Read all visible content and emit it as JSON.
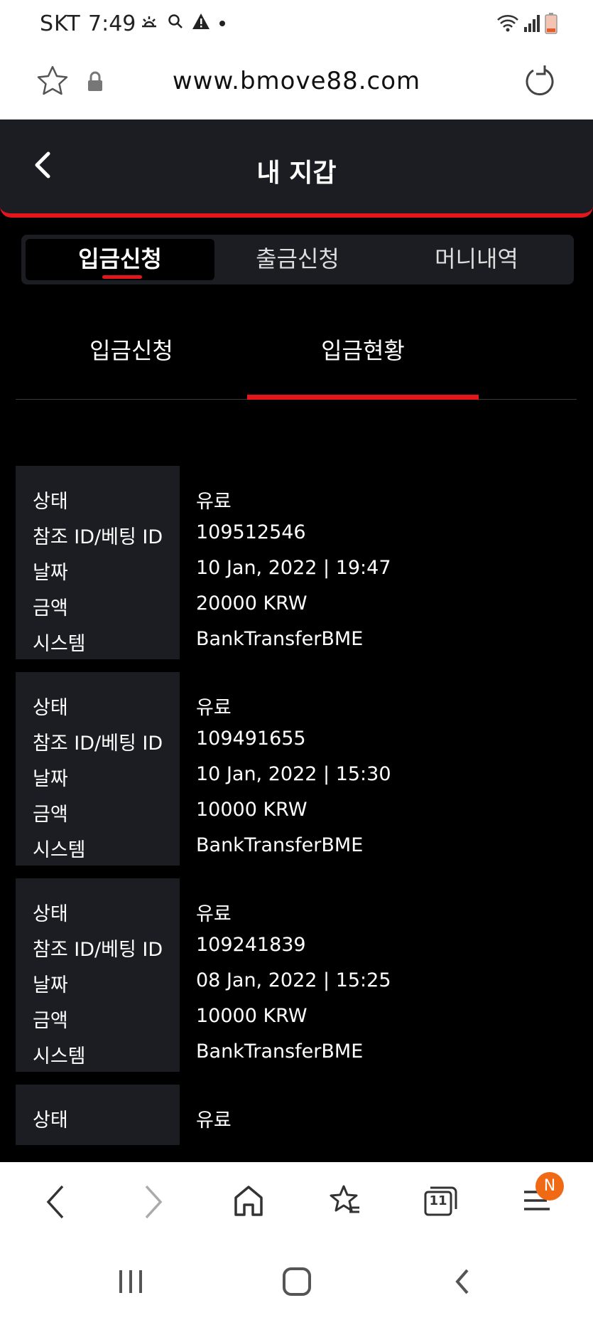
{
  "status_bar": {
    "carrier": "SKT",
    "time": "7:49",
    "icons": [
      "weather-icon",
      "search-icon",
      "warning-icon",
      "dot-icon",
      "wifi-icon",
      "signal-icon",
      "battery-icon"
    ]
  },
  "browser": {
    "url": "www.bmove88.com",
    "icons": [
      "star-icon",
      "lock-icon",
      "reload-icon"
    ]
  },
  "header": {
    "title": "내 지갑"
  },
  "main_tabs": [
    {
      "label": "입금신청",
      "active": true
    },
    {
      "label": "출금신청",
      "active": false
    },
    {
      "label": "머니내역",
      "active": false
    }
  ],
  "sub_tabs": [
    {
      "label": "입금신청",
      "active": false
    },
    {
      "label": "입금현황",
      "active": true
    }
  ],
  "field_labels": [
    "상태",
    "참조 ID/베팅 ID",
    "날짜",
    "금액",
    "시스템"
  ],
  "records": [
    {
      "status": "유료",
      "ref_id": "109512546",
      "date": "10 Jan, 2022 | 19:47",
      "amount": "20000 KRW",
      "system": "BankTransferBME"
    },
    {
      "status": "유료",
      "ref_id": "109491655",
      "date": "10 Jan, 2022 | 15:30",
      "amount": "10000 KRW",
      "system": "BankTransferBME"
    },
    {
      "status": "유료",
      "ref_id": "109241839",
      "date": "08 Jan, 2022 | 15:25",
      "amount": "10000 KRW",
      "system": "BankTransferBME"
    },
    {
      "status": "유료",
      "ref_id": "",
      "date": "",
      "amount": "",
      "system": ""
    }
  ],
  "browser_nav": {
    "tabs_count": "11",
    "menu_badge": "N"
  },
  "colors": {
    "accent": "#e3161b",
    "panel": "#1c1d22",
    "badge": "#f06a16"
  }
}
